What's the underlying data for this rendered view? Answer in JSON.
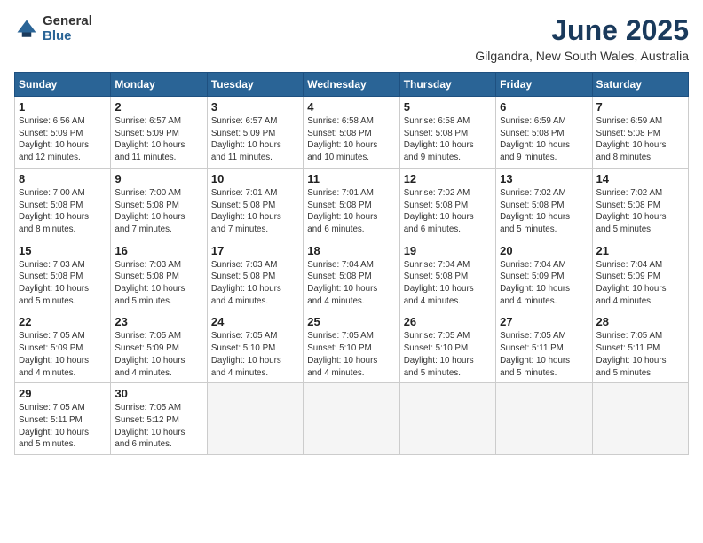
{
  "logo": {
    "general": "General",
    "blue": "Blue"
  },
  "title": {
    "month": "June 2025",
    "location": "Gilgandra, New South Wales, Australia"
  },
  "weekdays": [
    "Sunday",
    "Monday",
    "Tuesday",
    "Wednesday",
    "Thursday",
    "Friday",
    "Saturday"
  ],
  "days": [
    {
      "num": "",
      "info": ""
    },
    {
      "num": "",
      "info": ""
    },
    {
      "num": "",
      "info": ""
    },
    {
      "num": "",
      "info": ""
    },
    {
      "num": "",
      "info": ""
    },
    {
      "num": "",
      "info": ""
    },
    {
      "num": "",
      "info": ""
    },
    {
      "num": "1",
      "info": "Sunrise: 6:56 AM\nSunset: 5:09 PM\nDaylight: 10 hours\nand 12 minutes."
    },
    {
      "num": "2",
      "info": "Sunrise: 6:57 AM\nSunset: 5:09 PM\nDaylight: 10 hours\nand 11 minutes."
    },
    {
      "num": "3",
      "info": "Sunrise: 6:57 AM\nSunset: 5:09 PM\nDaylight: 10 hours\nand 11 minutes."
    },
    {
      "num": "4",
      "info": "Sunrise: 6:58 AM\nSunset: 5:08 PM\nDaylight: 10 hours\nand 10 minutes."
    },
    {
      "num": "5",
      "info": "Sunrise: 6:58 AM\nSunset: 5:08 PM\nDaylight: 10 hours\nand 9 minutes."
    },
    {
      "num": "6",
      "info": "Sunrise: 6:59 AM\nSunset: 5:08 PM\nDaylight: 10 hours\nand 9 minutes."
    },
    {
      "num": "7",
      "info": "Sunrise: 6:59 AM\nSunset: 5:08 PM\nDaylight: 10 hours\nand 8 minutes."
    },
    {
      "num": "8",
      "info": "Sunrise: 7:00 AM\nSunset: 5:08 PM\nDaylight: 10 hours\nand 8 minutes."
    },
    {
      "num": "9",
      "info": "Sunrise: 7:00 AM\nSunset: 5:08 PM\nDaylight: 10 hours\nand 7 minutes."
    },
    {
      "num": "10",
      "info": "Sunrise: 7:01 AM\nSunset: 5:08 PM\nDaylight: 10 hours\nand 7 minutes."
    },
    {
      "num": "11",
      "info": "Sunrise: 7:01 AM\nSunset: 5:08 PM\nDaylight: 10 hours\nand 6 minutes."
    },
    {
      "num": "12",
      "info": "Sunrise: 7:02 AM\nSunset: 5:08 PM\nDaylight: 10 hours\nand 6 minutes."
    },
    {
      "num": "13",
      "info": "Sunrise: 7:02 AM\nSunset: 5:08 PM\nDaylight: 10 hours\nand 5 minutes."
    },
    {
      "num": "14",
      "info": "Sunrise: 7:02 AM\nSunset: 5:08 PM\nDaylight: 10 hours\nand 5 minutes."
    },
    {
      "num": "15",
      "info": "Sunrise: 7:03 AM\nSunset: 5:08 PM\nDaylight: 10 hours\nand 5 minutes."
    },
    {
      "num": "16",
      "info": "Sunrise: 7:03 AM\nSunset: 5:08 PM\nDaylight: 10 hours\nand 5 minutes."
    },
    {
      "num": "17",
      "info": "Sunrise: 7:03 AM\nSunset: 5:08 PM\nDaylight: 10 hours\nand 4 minutes."
    },
    {
      "num": "18",
      "info": "Sunrise: 7:04 AM\nSunset: 5:08 PM\nDaylight: 10 hours\nand 4 minutes."
    },
    {
      "num": "19",
      "info": "Sunrise: 7:04 AM\nSunset: 5:08 PM\nDaylight: 10 hours\nand 4 minutes."
    },
    {
      "num": "20",
      "info": "Sunrise: 7:04 AM\nSunset: 5:09 PM\nDaylight: 10 hours\nand 4 minutes."
    },
    {
      "num": "21",
      "info": "Sunrise: 7:04 AM\nSunset: 5:09 PM\nDaylight: 10 hours\nand 4 minutes."
    },
    {
      "num": "22",
      "info": "Sunrise: 7:05 AM\nSunset: 5:09 PM\nDaylight: 10 hours\nand 4 minutes."
    },
    {
      "num": "23",
      "info": "Sunrise: 7:05 AM\nSunset: 5:09 PM\nDaylight: 10 hours\nand 4 minutes."
    },
    {
      "num": "24",
      "info": "Sunrise: 7:05 AM\nSunset: 5:10 PM\nDaylight: 10 hours\nand 4 minutes."
    },
    {
      "num": "25",
      "info": "Sunrise: 7:05 AM\nSunset: 5:10 PM\nDaylight: 10 hours\nand 4 minutes."
    },
    {
      "num": "26",
      "info": "Sunrise: 7:05 AM\nSunset: 5:10 PM\nDaylight: 10 hours\nand 5 minutes."
    },
    {
      "num": "27",
      "info": "Sunrise: 7:05 AM\nSunset: 5:11 PM\nDaylight: 10 hours\nand 5 minutes."
    },
    {
      "num": "28",
      "info": "Sunrise: 7:05 AM\nSunset: 5:11 PM\nDaylight: 10 hours\nand 5 minutes."
    },
    {
      "num": "29",
      "info": "Sunrise: 7:05 AM\nSunset: 5:11 PM\nDaylight: 10 hours\nand 5 minutes."
    },
    {
      "num": "30",
      "info": "Sunrise: 7:05 AM\nSunset: 5:12 PM\nDaylight: 10 hours\nand 6 minutes."
    },
    {
      "num": "",
      "info": ""
    },
    {
      "num": "",
      "info": ""
    },
    {
      "num": "",
      "info": ""
    },
    {
      "num": "",
      "info": ""
    },
    {
      "num": "",
      "info": ""
    }
  ]
}
